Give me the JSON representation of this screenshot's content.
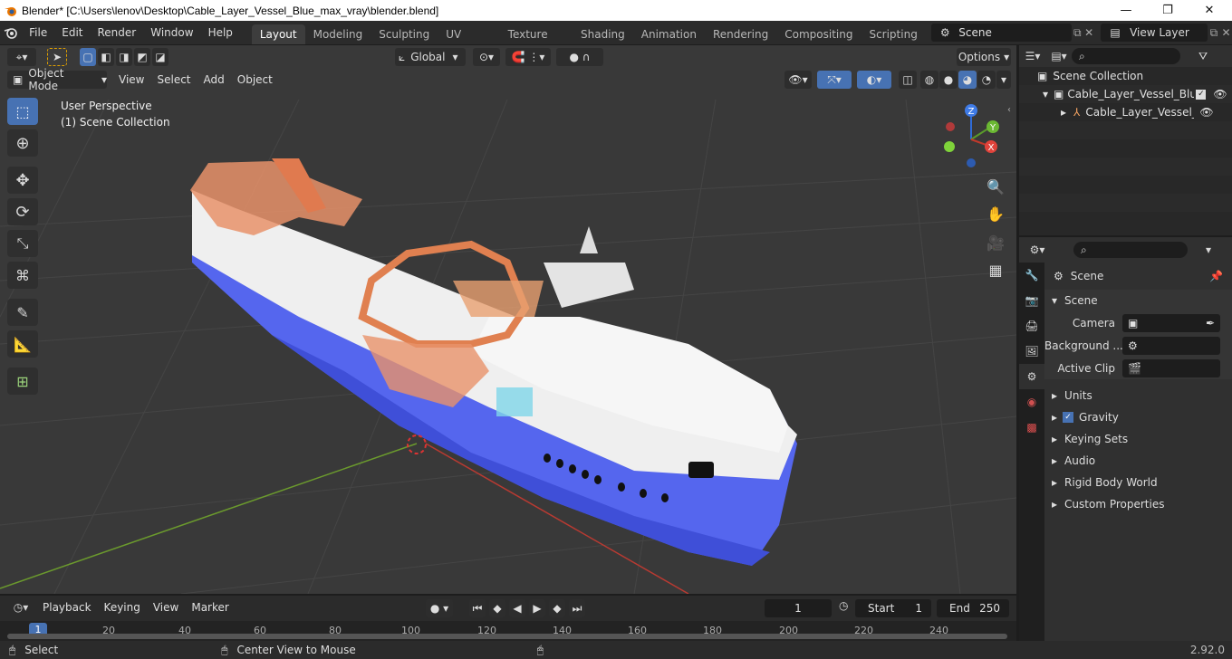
{
  "window": {
    "title": "Blender* [C:\\Users\\lenov\\Desktop\\Cable_Layer_Vessel_Blue_max_vray\\blender.blend]",
    "minimize": "—",
    "maximize": "❐",
    "close": "✕"
  },
  "menu": [
    "File",
    "Edit",
    "Render",
    "Window",
    "Help"
  ],
  "workspaces": [
    "Layout",
    "Modeling",
    "Sculpting",
    "UV Editing",
    "Texture Paint",
    "Shading",
    "Animation",
    "Rendering",
    "Compositing",
    "Scripting"
  ],
  "scene_field": "Scene",
  "view_layer_field": "View Layer",
  "viewport": {
    "transform_orientation": "Global",
    "options_label": "Options",
    "mode": "Object Mode",
    "header_menus": [
      "View",
      "Select",
      "Add",
      "Object"
    ],
    "overlay_line1": "User Perspective",
    "overlay_line2": "(1) Scene Collection",
    "gizmo": {
      "z": "Z",
      "y": "Y",
      "x": "X"
    }
  },
  "outliner": {
    "rows": [
      "Scene Collection",
      "Cable_Layer_Vessel_Blue",
      "Cable_Layer_Vessel_"
    ]
  },
  "properties": {
    "context": "Scene",
    "panel_title": "Scene",
    "fields": [
      {
        "label": "Camera"
      },
      {
        "label": "Background ..."
      },
      {
        "label": "Active Clip"
      }
    ],
    "subpanels": [
      "Units",
      "Gravity",
      "Keying Sets",
      "Audio",
      "Rigid Body World",
      "Custom Properties"
    ],
    "gravity_checked": true
  },
  "timeline": {
    "menus": [
      "Playback",
      "Keying",
      "View",
      "Marker"
    ],
    "current_frame": "1",
    "start_label": "Start",
    "start": "1",
    "end_label": "End",
    "end": "250",
    "ticks": [
      "1",
      "20",
      "40",
      "60",
      "80",
      "100",
      "120",
      "140",
      "160",
      "180",
      "200",
      "220",
      "240"
    ]
  },
  "status": {
    "left": "Select",
    "middle": "Center View to Mouse",
    "version": "2.92.0"
  },
  "colors": {
    "accent": "#4772b3",
    "hull_blue": "#4a5cf0",
    "orange_structure": "#e8926a",
    "viewport_bg": "#393939",
    "grid_line": "#464646",
    "x_axis": "#c0392b",
    "y_axis": "#6b9a2d"
  },
  "icons": [
    "blender-logo-icon",
    "select-box-icon",
    "cursor-icon",
    "move-icon",
    "rotate-icon",
    "scale-icon",
    "transform-icon",
    "annotate-icon",
    "measure-icon",
    "add-cube-icon",
    "zoom-icon",
    "hand-icon",
    "camera-icon",
    "grid-icon",
    "eye-icon",
    "filter-icon",
    "search-icon",
    "pin-icon",
    "play-icon",
    "clock-icon"
  ]
}
